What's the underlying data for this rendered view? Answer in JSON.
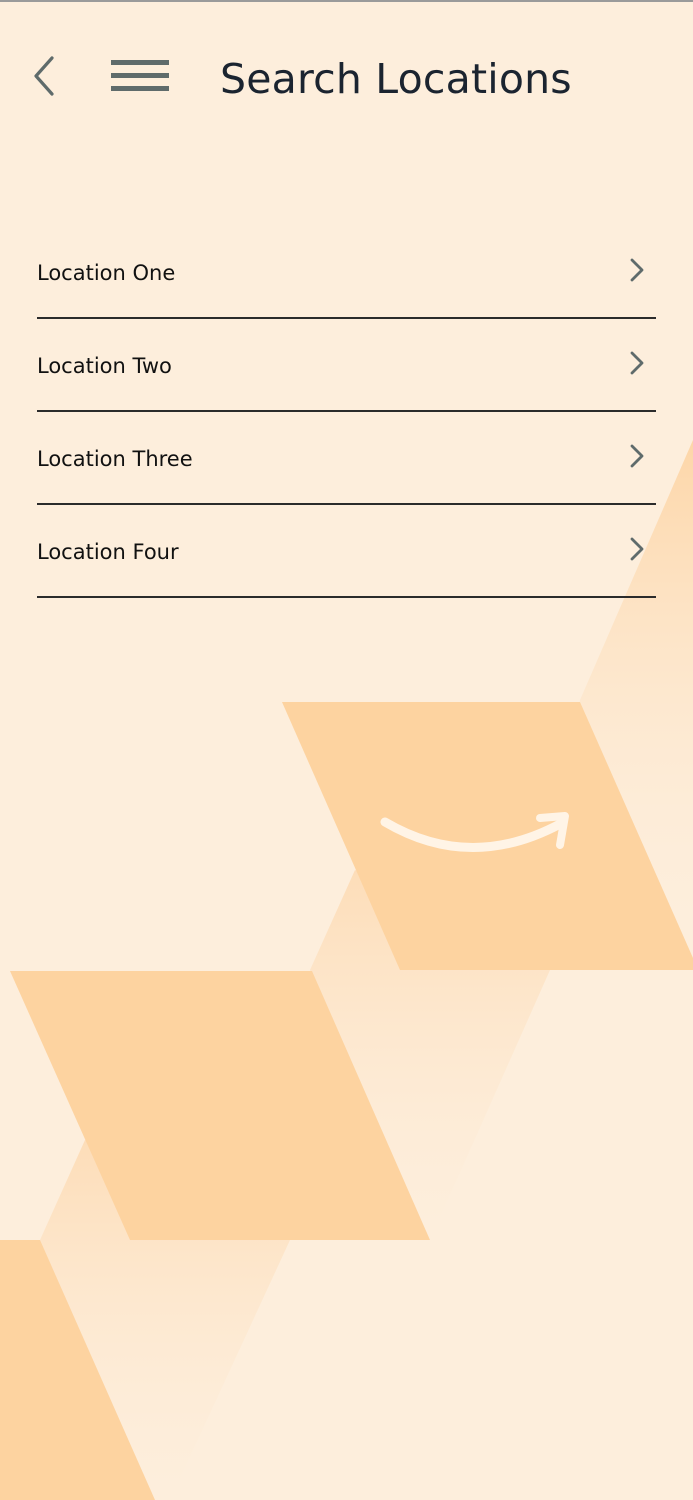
{
  "header": {
    "title": "Search Locations",
    "back_icon": "chevron-left-icon",
    "menu_icon": "hamburger-menu-icon"
  },
  "locations": [
    {
      "label": "Location One",
      "icon": "chevron-right-icon"
    },
    {
      "label": "Location Two",
      "icon": "chevron-right-icon"
    },
    {
      "label": "Location Three",
      "icon": "chevron-right-icon"
    },
    {
      "label": "Location Four",
      "icon": "chevron-right-icon"
    }
  ],
  "background": {
    "logo": "amazon-smile-logo",
    "colors": {
      "base": "#FDEEDC",
      "tile": "#FDD3A0",
      "tile_fade": "#FDE0BE",
      "text": "#1b2430",
      "divider": "#2b2b2b",
      "icon_gray": "#5f6b6b"
    }
  }
}
